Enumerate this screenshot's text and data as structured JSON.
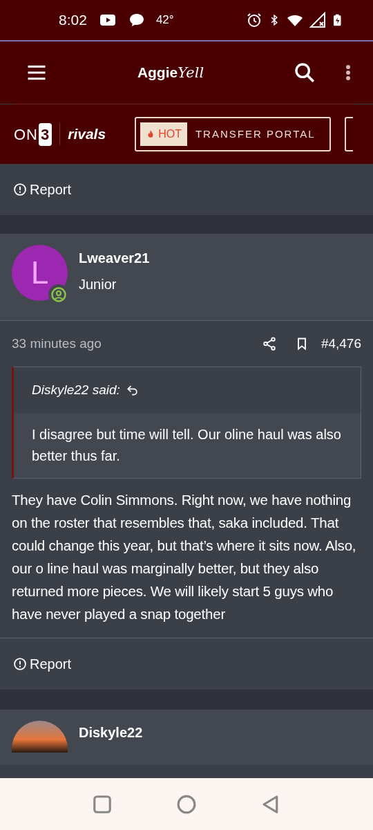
{
  "status_bar": {
    "time": "8:02",
    "temperature": "42°"
  },
  "header": {
    "logo_main": "Aggie",
    "logo_script": "Yell"
  },
  "brand_row": {
    "logo_on3_text": "ON",
    "logo_on3_digit": "3",
    "logo_rivals": "rivals",
    "hot_label": "HOT",
    "banner": "TRANSFER PORTAL"
  },
  "top_report": {
    "label": "Report"
  },
  "post": {
    "author": "Lweaver21",
    "initial": "L",
    "color": "#9c27b0",
    "rank": "Junior",
    "online": true,
    "time": "33 minutes ago",
    "number": "#4,476",
    "quote": {
      "author": "Diskyle22 said:",
      "text": "I disagree but time will tell. Our oline haul was also better thus far."
    },
    "body": "They have Colin Simmons. Right now, we have nothing on the roster that resembles that, saka included. That could change this year, but that’s where it sits now. Also, our o line haul was marginally better, but they also returned more pieces. We will likely start 5 guys who have never played a snap together",
    "report": "Report"
  },
  "next_post": {
    "author": "Diskyle22"
  }
}
